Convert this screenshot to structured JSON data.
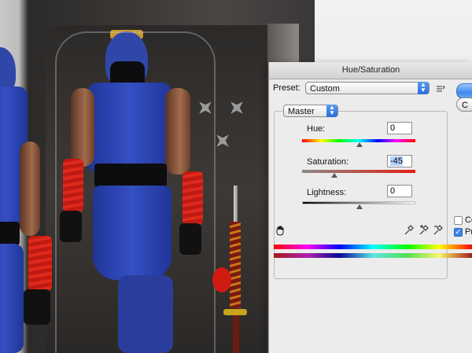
{
  "dialog": {
    "title": "Hue/Saturation",
    "preset_label": "Preset:",
    "preset_value": "Custom",
    "channel_value": "Master",
    "hue": {
      "label": "Hue:",
      "value": "0"
    },
    "saturation": {
      "label": "Saturation:",
      "value": "-45"
    },
    "lightness": {
      "label": "Lightness:",
      "value": "0"
    },
    "cancel_partial": "C",
    "colorize_partial": "Co",
    "preview_partial": "Pre"
  },
  "colors": {
    "accent": "#3c84ec",
    "dialog_bg": "#ececec"
  },
  "icons": [
    "preset-options-icon",
    "chevron-updown-icon",
    "hand-target-icon",
    "eyedropper-icon",
    "eyedropper-plus-icon",
    "eyedropper-minus-icon"
  ]
}
